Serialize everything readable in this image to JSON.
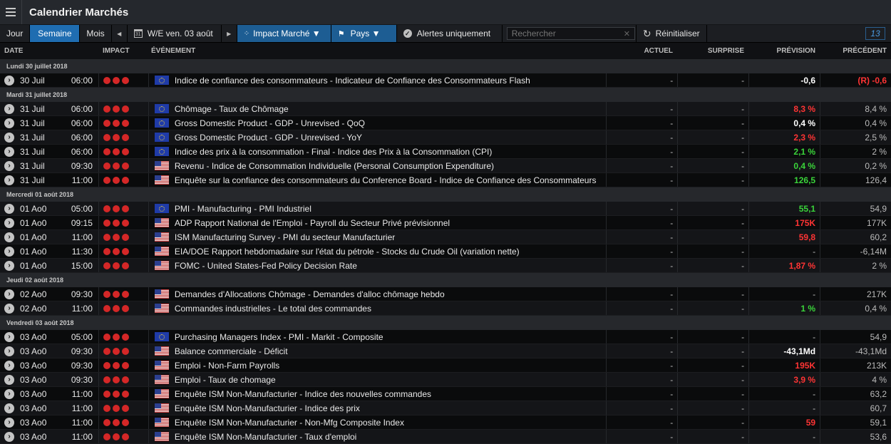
{
  "app": {
    "title": "Calendrier Marchés"
  },
  "toolbar": {
    "jour": "Jour",
    "semaine": "Semaine",
    "mois": "Mois",
    "prev": "◀",
    "date_label": "W/E ven. 03 août",
    "cal_icon_text": "31",
    "next": "▶",
    "impact_label": "Impact Marché ▼",
    "pays_label": "Pays ▼",
    "alertes_label": "Alertes uniquement",
    "search_placeholder": "Rechercher",
    "reset_label": "Réinitialiser",
    "badge": "13"
  },
  "columns": {
    "date": "DATE",
    "impact": "IMPACT",
    "event": "ÉVÉNEMENT",
    "actuel": "ACTUEL",
    "surprise": "SURPRISE",
    "prevision": "PRÉVISION",
    "precedent": "PRÉCÉDENT"
  },
  "rows": [
    {
      "group": "Lundi 30 juillet 2018"
    },
    {
      "date": "30 Juil",
      "time": "06:00",
      "flag": "eu",
      "event": "Indice de confiance des consommateurs - Indicateur de Confiance des Consommateurs Flash",
      "actuel": "-",
      "surprise": "-",
      "prevision": "-0,6",
      "prev_color": "white",
      "precedent": "(R) -0,6",
      "prec_color": "red"
    },
    {
      "group": "Mardi 31 juillet 2018"
    },
    {
      "date": "31 Juil",
      "time": "06:00",
      "flag": "eu",
      "event": "Chômage - Taux de Chômage",
      "actuel": "-",
      "surprise": "-",
      "prevision": "8,3 %",
      "prev_color": "red",
      "precedent": "8,4 %",
      "prec_color": ""
    },
    {
      "date": "31 Juil",
      "time": "06:00",
      "flag": "eu",
      "event": "Gross Domestic Product - GDP - Unrevised - QoQ",
      "actuel": "-",
      "surprise": "-",
      "prevision": "0,4 %",
      "prev_color": "white",
      "precedent": "0,4 %",
      "prec_color": ""
    },
    {
      "date": "31 Juil",
      "time": "06:00",
      "flag": "eu",
      "event": "Gross Domestic Product - GDP - Unrevised - YoY",
      "actuel": "-",
      "surprise": "-",
      "prevision": "2,3 %",
      "prev_color": "red",
      "precedent": "2,5 %",
      "prec_color": ""
    },
    {
      "date": "31 Juil",
      "time": "06:00",
      "flag": "eu",
      "event": "Indice des prix à la consommation - Final - Indice des Prix à la Consommation (CPI)",
      "actuel": "-",
      "surprise": "-",
      "prevision": "2,1 %",
      "prev_color": "green",
      "precedent": "2 %",
      "prec_color": ""
    },
    {
      "date": "31 Juil",
      "time": "09:30",
      "flag": "us",
      "event": "Revenu - Indice de Consommation Individuelle (Personal Consumption Expenditure)",
      "actuel": "-",
      "surprise": "-",
      "prevision": "0,4 %",
      "prev_color": "green",
      "precedent": "0,2 %",
      "prec_color": ""
    },
    {
      "date": "31 Juil",
      "time": "11:00",
      "flag": "us",
      "event": "Enquête sur la confiance des consommateurs du Conference Board - Indice de Confiance des Consommateurs",
      "actuel": "-",
      "surprise": "-",
      "prevision": "126,5",
      "prev_color": "green",
      "precedent": "126,4",
      "prec_color": ""
    },
    {
      "group": "Mercredi 01 août 2018"
    },
    {
      "date": "01 Ao0",
      "time": "05:00",
      "flag": "eu",
      "event": "PMI - Manufacturing - PMI Industriel",
      "actuel": "-",
      "surprise": "-",
      "prevision": "55,1",
      "prev_color": "green",
      "precedent": "54,9",
      "prec_color": ""
    },
    {
      "date": "01 Ao0",
      "time": "09:15",
      "flag": "us",
      "event": "ADP Rapport National de l'Emploi - Payroll du Secteur Privé prévisionnel",
      "actuel": "-",
      "surprise": "-",
      "prevision": "175K",
      "prev_color": "red",
      "precedent": "177K",
      "prec_color": ""
    },
    {
      "date": "01 Ao0",
      "time": "11:00",
      "flag": "us",
      "event": "ISM Manufacturing Survey - PMI du secteur Manufacturier",
      "actuel": "-",
      "surprise": "-",
      "prevision": "59,8",
      "prev_color": "red",
      "precedent": "60,2",
      "prec_color": ""
    },
    {
      "date": "01 Ao0",
      "time": "11:30",
      "flag": "us",
      "event": "EIA/DOE Rapport hebdomadaire sur l'état du pétrole - Stocks du Crude Oil (variation nette)",
      "actuel": "-",
      "surprise": "-",
      "prevision": "-",
      "prev_color": "",
      "precedent": "-6,14M",
      "prec_color": ""
    },
    {
      "date": "01 Ao0",
      "time": "15:00",
      "flag": "us",
      "event": "FOMC - United States-Fed Policy Decision Rate",
      "actuel": "-",
      "surprise": "-",
      "prevision": "1,87 %",
      "prev_color": "red",
      "precedent": "2 %",
      "prec_color": ""
    },
    {
      "group": "Jeudi 02 août 2018"
    },
    {
      "date": "02 Ao0",
      "time": "09:30",
      "flag": "us",
      "event": "Demandes d'Allocations Chômage - Demandes d'alloc chômage hebdo",
      "actuel": "-",
      "surprise": "-",
      "prevision": "-",
      "prev_color": "",
      "precedent": "217K",
      "prec_color": ""
    },
    {
      "date": "02 Ao0",
      "time": "11:00",
      "flag": "us",
      "event": "Commandes industrielles - Le total des commandes",
      "actuel": "-",
      "surprise": "-",
      "prevision": "1 %",
      "prev_color": "green",
      "precedent": "0,4 %",
      "prec_color": ""
    },
    {
      "group": "Vendredi 03 août 2018"
    },
    {
      "date": "03 Ao0",
      "time": "05:00",
      "flag": "eu",
      "event": "Purchasing Managers Index - PMI - Markit - Composite",
      "actuel": "-",
      "surprise": "-",
      "prevision": "-",
      "prev_color": "",
      "precedent": "54,9",
      "prec_color": ""
    },
    {
      "date": "03 Ao0",
      "time": "09:30",
      "flag": "us",
      "event": "Balance commerciale - Déficit",
      "actuel": "-",
      "surprise": "-",
      "prevision": "-43,1Md",
      "prev_color": "white",
      "precedent": "-43,1Md",
      "prec_color": ""
    },
    {
      "date": "03 Ao0",
      "time": "09:30",
      "flag": "us",
      "event": "Emploi - Non-Farm Payrolls",
      "actuel": "-",
      "surprise": "-",
      "prevision": "195K",
      "prev_color": "red",
      "precedent": "213K",
      "prec_color": ""
    },
    {
      "date": "03 Ao0",
      "time": "09:30",
      "flag": "us",
      "event": "Emploi - Taux de chomage",
      "actuel": "-",
      "surprise": "-",
      "prevision": "3,9 %",
      "prev_color": "red",
      "precedent": "4 %",
      "prec_color": ""
    },
    {
      "date": "03 Ao0",
      "time": "11:00",
      "flag": "us",
      "event": "Enquête ISM Non-Manufacturier - Indice des nouvelles commandes",
      "actuel": "-",
      "surprise": "-",
      "prevision": "-",
      "prev_color": "",
      "precedent": "63,2",
      "prec_color": ""
    },
    {
      "date": "03 Ao0",
      "time": "11:00",
      "flag": "us",
      "event": "Enquête ISM Non-Manufacturier - Indice des prix",
      "actuel": "-",
      "surprise": "-",
      "prevision": "-",
      "prev_color": "",
      "precedent": "60,7",
      "prec_color": ""
    },
    {
      "date": "03 Ao0",
      "time": "11:00",
      "flag": "us",
      "event": "Enquête ISM Non-Manufacturier - Non-Mfg Composite Index",
      "actuel": "-",
      "surprise": "-",
      "prevision": "59",
      "prev_color": "red",
      "precedent": "59,1",
      "prec_color": ""
    },
    {
      "date": "03 Ao0",
      "time": "11:00",
      "flag": "us",
      "event": "Enquête ISM Non-Manufacturier - Taux d'emploi",
      "actuel": "-",
      "surprise": "-",
      "prevision": "-",
      "prev_color": "",
      "precedent": "53,6",
      "prec_color": ""
    }
  ]
}
